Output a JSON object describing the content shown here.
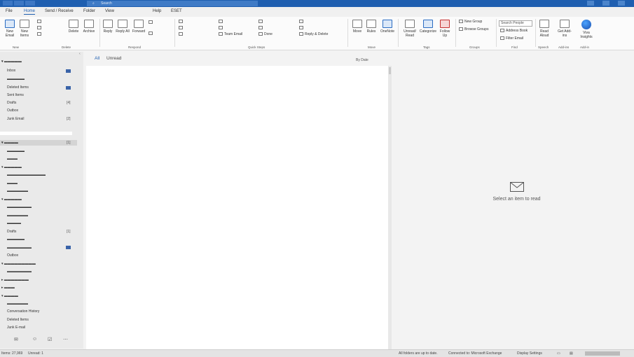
{
  "titlebar": {
    "search_placeholder": "Search"
  },
  "menu": {
    "tabs": [
      "File",
      "Home",
      "Send / Receive",
      "Folder",
      "View",
      "Help",
      "ESET"
    ]
  },
  "ribbon": {
    "new_email": "New Email",
    "new_items": "New Items",
    "delete": "Delete",
    "archive": "Archive",
    "reply": "Reply",
    "reply_all": "Reply All",
    "forward": "Forward",
    "quick_steps": [
      "Team Email",
      "Done",
      "Reply & Delete"
    ],
    "move": "Move",
    "rules": "Rules",
    "onenote": "OneNote",
    "unread_read": "Unread/ Read",
    "categorize": "Categorize",
    "follow_up": "Follow Up",
    "new_group": "New Group",
    "browse_groups": "Browse Groups",
    "search_people": "Search People",
    "address_book": "Address Book",
    "filter_email": "Filter Email",
    "read_aloud": "Read Aloud",
    "get_addins": "Get Add-ins",
    "viva_insights": "Viva Insights",
    "groups": [
      "New",
      "Delete",
      "Respond",
      "Quick Steps",
      "Move",
      "Tags",
      "Groups",
      "Find",
      "Speech",
      "Add-ins",
      "Add-in"
    ]
  },
  "folders": {
    "items": [
      {
        "label": "Inbox",
        "count": "",
        "bold": false
      },
      {
        "label": "Sent Items",
        "count": "",
        "bold": false
      },
      {
        "label": "Deleted Items",
        "count": "",
        "bold": false
      },
      {
        "label": "Drafts",
        "count": "[4]",
        "bold": false
      },
      {
        "label": "Outbox",
        "count": "",
        "bold": false
      },
      {
        "label": "Junk Email",
        "count": "[2]",
        "bold": false
      }
    ],
    "lower_items": [
      {
        "label": "Drafts",
        "count": "[1]"
      },
      {
        "label": "Conversation History",
        "count": ""
      },
      {
        "label": "Deleted Items",
        "count": ""
      },
      {
        "label": "Junk E-mail",
        "count": ""
      }
    ],
    "search_folders": "Search Folders",
    "outbox_label": "Outbox"
  },
  "list": {
    "filter_all": "All",
    "filter_unread": "Unread",
    "sort": "By Date"
  },
  "reading_pane": {
    "message": "Select an item to read"
  },
  "status": {
    "items": "Items: 27,969",
    "unread": "Unread: 1",
    "sync": "All folders are up to date.",
    "connection": "Connected to: Microsoft Exchange",
    "display_settings": "Display Settings"
  }
}
